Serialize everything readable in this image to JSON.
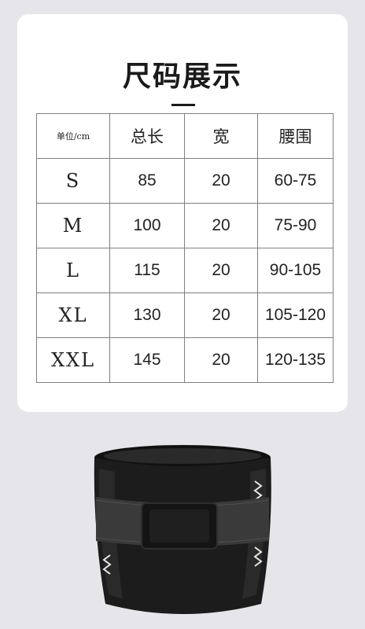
{
  "title": "尺码展示",
  "table": {
    "header": [
      "单位/cm",
      "总长",
      "宽",
      "腰围"
    ],
    "rows": [
      {
        "size": "S",
        "length": "85",
        "width": "20",
        "waist": "60-75"
      },
      {
        "size": "M",
        "length": "100",
        "width": "20",
        "waist": "75-90"
      },
      {
        "size": "L",
        "length": "115",
        "width": "20",
        "waist": "90-105"
      },
      {
        "size": "XL",
        "length": "130",
        "width": "20",
        "waist": "105-120"
      },
      {
        "size": "XXL",
        "length": "145",
        "width": "20",
        "waist": "120-135"
      }
    ]
  },
  "colors": {
    "background": "#e6e5ea",
    "card": "#ffffff",
    "belt": "#1c1c1c",
    "strap": "#2e2e2e"
  }
}
